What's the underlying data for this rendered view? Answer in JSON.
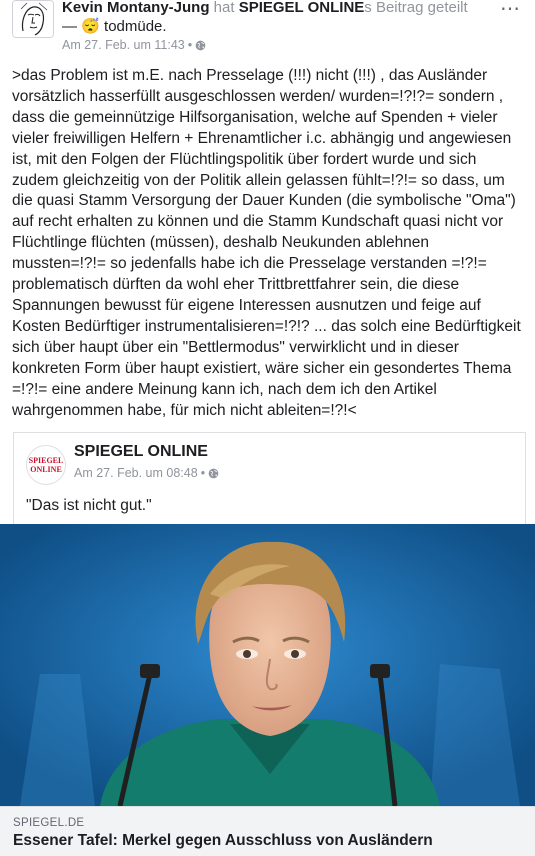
{
  "post": {
    "author": "Kevin Montany-Jung",
    "shared_word": " hat ",
    "page": "SPIEGEL ONLINE",
    "shared_suffix": "s Beitrag geteilt",
    "feeling_prefix": "— ",
    "feeling_emoji": "😴",
    "feeling_text": " todmüde.",
    "timestamp": "Am 27. Feb. um 11:43",
    "separator": "•",
    "privacy_icon": "globe-icon",
    "more_icon": "ellipsis-icon",
    "more_glyph": "⋯",
    "text": ">das Problem ist m.E. nach Presselage (!!!) nicht (!!!) ,  das Ausländer vorsätzlich hasserfüllt ausgeschlossen werden/ wurden=!?!?= sondern , dass die gemeinnützige Hilfsorganisation, welche auf Spenden + vieler vieler freiwilligen Helfern +  Ehrenamtlicher i.c.  abhängig und angewiesen ist, mit den Folgen der Flüchtlingspolitik über fordert wurde und sich zudem gleichzeitig von der Politik allein gelassen fühlt=!?!= so dass, um die quasi Stamm Versorgung der Dauer Kunden (die symbolische \"Oma\") auf recht erhalten zu können und die Stamm Kundschaft quasi nicht vor Flüchtlinge flüchten (müssen), deshalb Neukunden ablehnen mussten=!?!= so jedenfalls habe ich die Presselage verstanden =!?!= problematisch dürften da wohl eher Trittbrettfahrer sein, die diese Spannungen bewusst für eigene Interessen ausnutzen und feige auf Kosten Bedürftiger instrumentalisieren=!?!? ... das solch eine Bedürftigkeit sich über haupt über ein \"Bettlermodus\"  verwirklicht und in dieser konkreten Form  über haupt existiert, wäre sicher ein gesondertes Thema =!?!= eine andere Meinung kann ich, nach dem ich den Artikel wahrgenommen habe, für mich nicht ableiten=!?!<"
  },
  "shared": {
    "logo_line1": "SPIEGEL",
    "logo_line2": "ONLINE",
    "name": "SPIEGEL ONLINE",
    "timestamp": "Am 27. Feb. um 08:48",
    "separator": "•",
    "privacy_icon": "globe-icon",
    "quote": "\"Das ist nicht gut.\""
  },
  "link": {
    "domain": "SPIEGEL.DE",
    "title": "Essener Tafel: Merkel gegen Ausschluss von Ausländern"
  },
  "colors": {
    "text": "#1c1e21",
    "muted": "#90949c",
    "spiegel_red": "#c8102e",
    "photo_blue": "#1a73b8",
    "link_bg": "#f2f3f5"
  }
}
